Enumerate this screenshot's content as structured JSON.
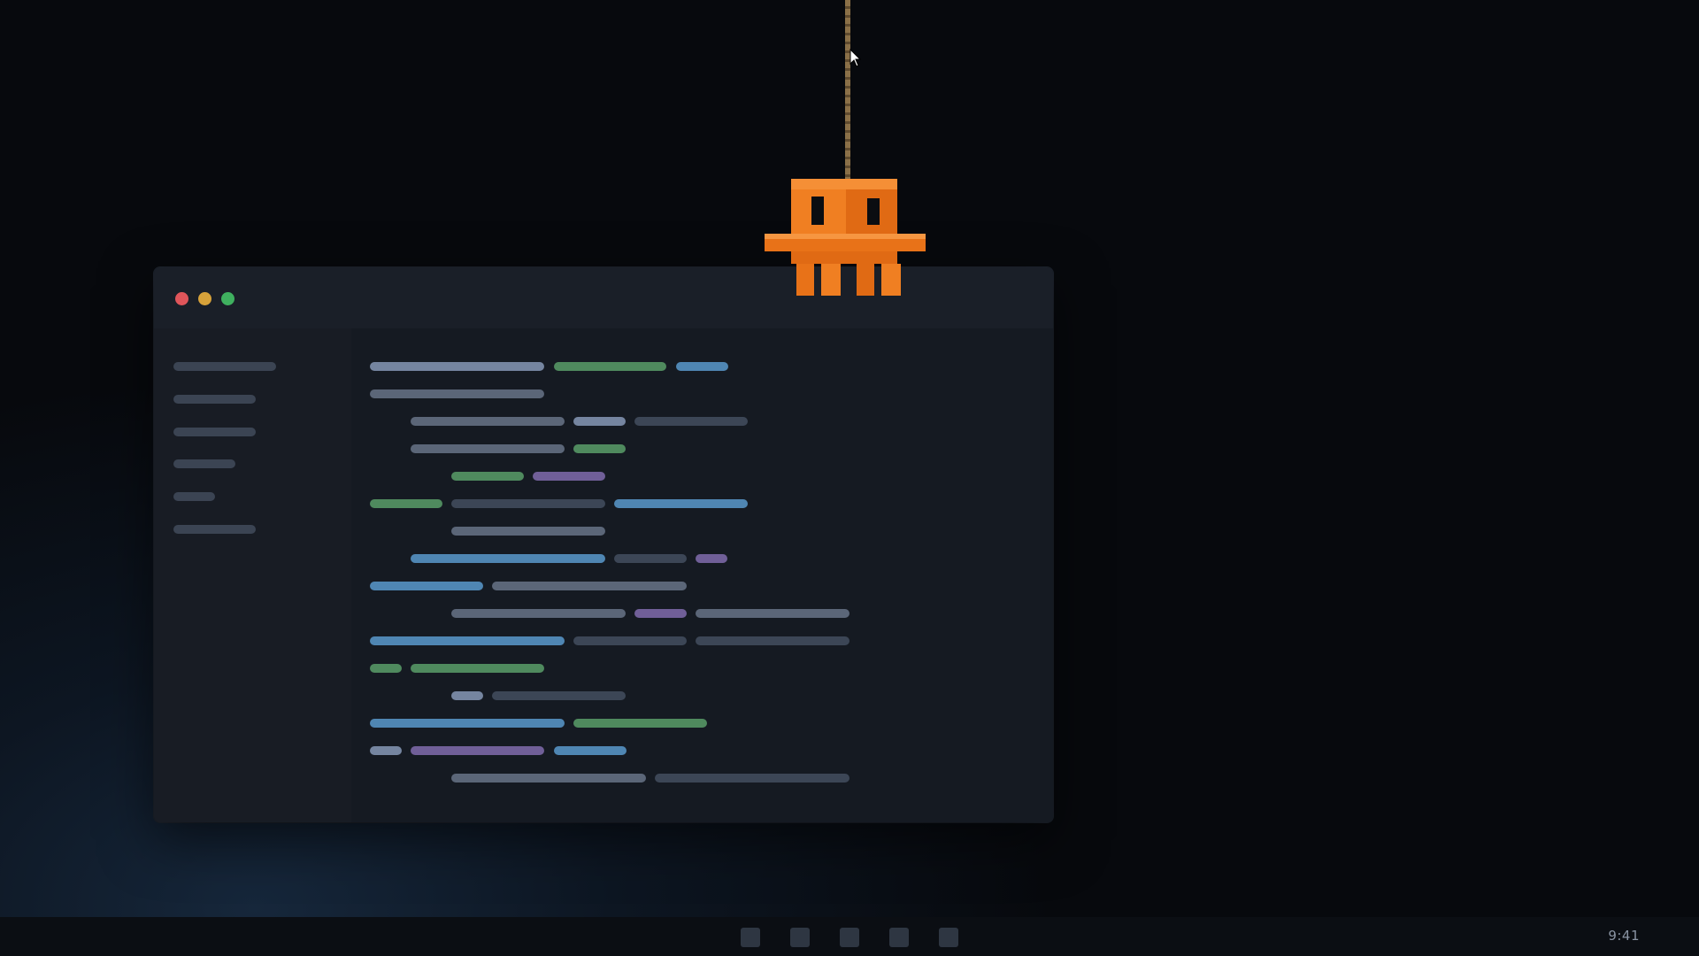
{
  "window": {
    "traffic_lights": [
      {
        "name": "close",
        "color": "#e0555a"
      },
      {
        "name": "minimize",
        "color": "#d7a23a"
      },
      {
        "name": "maximize",
        "color": "#3fb05f"
      }
    ]
  },
  "mascot": {
    "description_icon": "orange-pixel-creature-icon",
    "color": "#f07f22",
    "rope_icon": "rope-icon"
  },
  "taskbar": {
    "apps": [
      "app-1",
      "app-2",
      "app-3",
      "app-4",
      "app-5"
    ],
    "clock": "9:41"
  },
  "colors": {
    "accent_green": "#4f8a5e",
    "accent_blue": "#4f86b3",
    "accent_purple": "#705f98",
    "mascot_orange": "#f07f22"
  }
}
